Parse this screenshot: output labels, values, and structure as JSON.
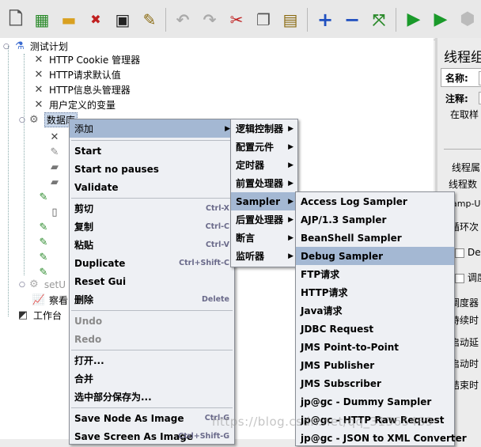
{
  "toolbar": {
    "buttons": [
      {
        "name": "new-icon",
        "glyph": "🗋"
      },
      {
        "name": "templates-icon",
        "glyph": "📗"
      },
      {
        "name": "open-icon",
        "glyph": "📂"
      },
      {
        "name": "close-icon",
        "glyph": "✖"
      },
      {
        "name": "save-icon",
        "glyph": "💾"
      },
      {
        "name": "save-as-icon",
        "glyph": "✎"
      },
      {
        "name": "undo-icon",
        "glyph": "↶"
      },
      {
        "name": "redo-icon",
        "glyph": "↷"
      },
      {
        "name": "cut-icon",
        "glyph": "✂"
      },
      {
        "name": "copy-icon",
        "glyph": "❐"
      },
      {
        "name": "paste-icon",
        "glyph": "📋"
      },
      {
        "name": "expand-icon",
        "glyph": "+"
      },
      {
        "name": "collapse-icon",
        "glyph": "−"
      },
      {
        "name": "toggle-icon",
        "glyph": "⤧"
      },
      {
        "name": "start-icon",
        "glyph": "▶"
      },
      {
        "name": "start-no-pause-icon",
        "glyph": "▶"
      },
      {
        "name": "stop-icon",
        "glyph": "■"
      }
    ]
  },
  "tree": {
    "root": "测试计划",
    "items": [
      "HTTP Cookie 管理器",
      "HTTP请求默认值",
      "HTTP信息头管理器",
      "用户定义的变量"
    ],
    "selected": "数据库",
    "setup_partial": "setU",
    "view_partial": "察看",
    "workbench": "工作台"
  },
  "right_panel": {
    "title": "线程组",
    "name_label": "名称:",
    "comment_label": "注释:",
    "on_error": "在取样",
    "props_title": "线程属",
    "thread_count": "线程数",
    "ramp": "amp-U",
    "loop": "循环次",
    "delay": "Dela",
    "scheduler_cb": "调度",
    "scheduler": "调度器",
    "duration": "持续时",
    "startup_delay": "启动延",
    "start_time": "启动时",
    "end_time": "结束时"
  },
  "context_menu": {
    "add": "添加",
    "start": "Start",
    "start_no_pauses": "Start no pauses",
    "validate": "Validate",
    "cut": "剪切",
    "cut_sc": "Ctrl-X",
    "copy": "复制",
    "copy_sc": "Ctrl-C",
    "paste": "粘贴",
    "paste_sc": "Ctrl-V",
    "duplicate": "Duplicate",
    "duplicate_sc": "Ctrl+Shift-C",
    "reset_gui": "Reset Gui",
    "delete": "删除",
    "delete_sc": "Delete",
    "undo": "Undo",
    "redo": "Redo",
    "open": "打开...",
    "merge": "合并",
    "save_selection": "选中部分保存为...",
    "save_node_image": "Save Node As Image",
    "save_node_image_sc": "Ctrl-G",
    "save_screen_image": "Save Screen As Image",
    "save_screen_image_sc": "Ctrl+Shift-G"
  },
  "add_menu": {
    "logic": "逻辑控制器",
    "config": "配置元件",
    "timer": "定时器",
    "preprocessor": "前置处理器",
    "sampler": "Sampler",
    "postprocessor": "后置处理器",
    "assertion": "断言",
    "listener": "监听器"
  },
  "sampler_menu": {
    "items": [
      "Access Log Sampler",
      "AJP/1.3 Sampler",
      "BeanShell Sampler",
      "Debug Sampler",
      "FTP请求",
      "HTTP请求",
      "Java请求",
      "JDBC Request",
      "JMS Point-to-Point",
      "JMS Publisher",
      "JMS Subscriber",
      "jp@gc - Dummy Sampler",
      "jp@gc - HTTP Raw Request",
      "jp@gc - JSON to XML Converter"
    ],
    "highlighted": "Debug Sampler"
  },
  "watermark": "https://blog.csdn.net/qq_31365469"
}
